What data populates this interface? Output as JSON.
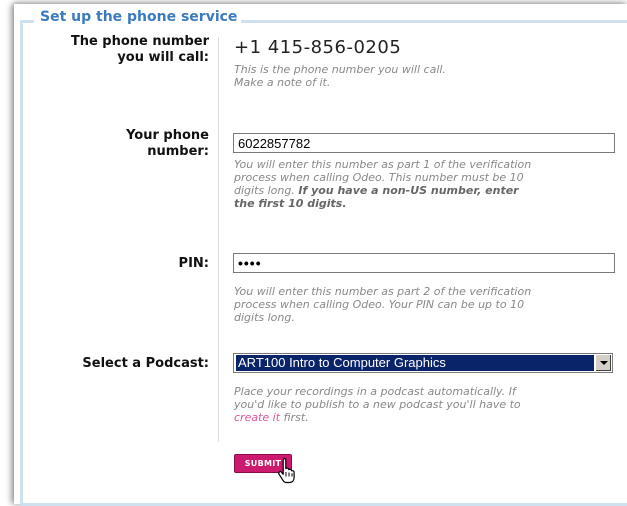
{
  "legend": "Set up the phone service",
  "call_number": {
    "label_line1": "The phone number",
    "label_line2": "you will call:",
    "value": "+1 415-856-0205",
    "hint_line1": "This is the phone number you will call.",
    "hint_line2": "Make a note of it."
  },
  "your_phone": {
    "label_line1": "Your phone",
    "label_line2": "number:",
    "value": "6022857782",
    "hint_line1": "You will enter this number as part 1 of the verification",
    "hint_line2": "process when calling Odeo. This number must be 10",
    "hint_line3_plain": "digits long. ",
    "hint_line3_bold": "If you have a non-US number, enter",
    "hint_line4_bold": "the first 10 digits."
  },
  "pin": {
    "label": "PIN:",
    "value": "••••",
    "hint_line1": "You will enter this number as part 2 of the verification",
    "hint_line2": "process when calling Odeo. Your PIN can be up to 10",
    "hint_line3": "digits long."
  },
  "podcast": {
    "label": "Select a Podcast:",
    "selected": "ART100 Intro to Computer Graphics",
    "hint_line1": "Place your recordings in a podcast automatically. If",
    "hint_line2": "you'd like to publish to a new podcast you'll have to",
    "hint_link": "create it",
    "hint_after_link": " first."
  },
  "submit_label": "SUBMIT",
  "colors": {
    "legend": "#3a7bbf",
    "fieldset_border": "#cfe1ef",
    "submit_bg": "#cc1a6e",
    "link": "#e0559a",
    "select_highlight": "#0a246a"
  },
  "icons": {
    "cursor": "hand-pointer-icon",
    "dropdown": "chevron-down-icon"
  }
}
